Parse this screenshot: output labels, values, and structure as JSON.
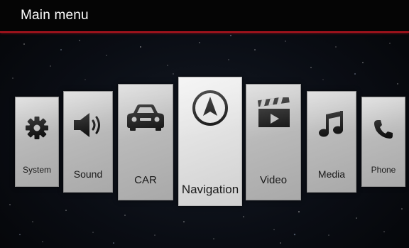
{
  "header": {
    "title": "Main menu"
  },
  "menu": {
    "items": [
      {
        "label": "System",
        "icon": "gear-icon"
      },
      {
        "label": "Sound",
        "icon": "speaker-icon"
      },
      {
        "label": "CAR",
        "icon": "car-icon"
      },
      {
        "label": "Navigation",
        "icon": "compass-arrow-icon",
        "selected": true
      },
      {
        "label": "Video",
        "icon": "clapperboard-icon"
      },
      {
        "label": "Media",
        "icon": "music-note-icon"
      },
      {
        "label": "Phone",
        "icon": "phone-icon"
      }
    ]
  },
  "colors": {
    "header_accent": "#b3141e",
    "tile": "#bcbcbc",
    "tile_selected": "#e6e6e6",
    "icon": "#111111",
    "background": "#0a0d14"
  }
}
